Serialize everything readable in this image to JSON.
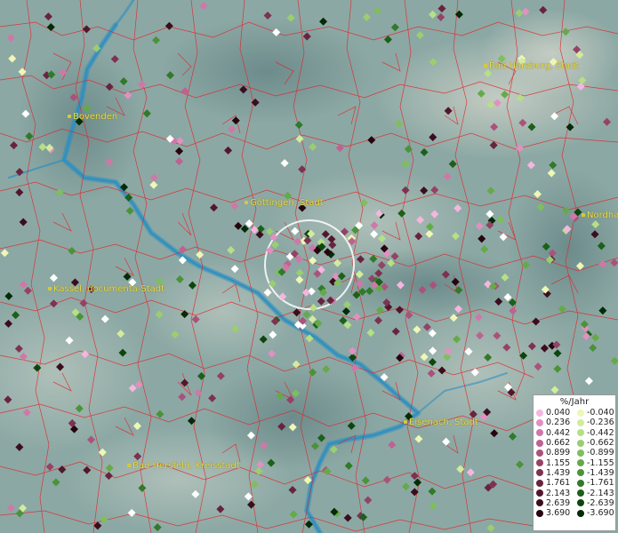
{
  "map": {
    "towns": [
      {
        "name": "Bad Harzburg, Stadt"
      },
      {
        "name": "Bovenden"
      },
      {
        "name": "Göttingen, Stadt"
      },
      {
        "name": "Nordhausen"
      },
      {
        "name": "Kassel, documenta-Stadt"
      },
      {
        "name": "Eisenach, Stadt"
      },
      {
        "name": "Bad Hersfeld, Kreisstadt"
      }
    ]
  },
  "legend": {
    "title": "%/Jahr",
    "positive": [
      {
        "label": "0.040",
        "color": "#f4b6df"
      },
      {
        "label": "0.236",
        "color": "#e190c2"
      },
      {
        "label": "0.442",
        "color": "#cf78a8"
      },
      {
        "label": "0.662",
        "color": "#bd6292"
      },
      {
        "label": "0.899",
        "color": "#a9527c"
      },
      {
        "label": "1.155",
        "color": "#944266"
      },
      {
        "label": "1.439",
        "color": "#7d3252"
      },
      {
        "label": "1.761",
        "color": "#68243f"
      },
      {
        "label": "2.143",
        "color": "#52172d"
      },
      {
        "label": "2.639",
        "color": "#3b0d1d"
      },
      {
        "label": "3.690",
        "color": "#26050f"
      }
    ],
    "negative": [
      {
        "label": "-0.040",
        "color": "#eef7b5"
      },
      {
        "label": "-0.236",
        "color": "#d2ec9c"
      },
      {
        "label": "-0.442",
        "color": "#b6df86"
      },
      {
        "label": "-0.662",
        "color": "#9ace70"
      },
      {
        "label": "-0.899",
        "color": "#7fbe5c"
      },
      {
        "label": "-1.155",
        "color": "#65aa49"
      },
      {
        "label": "-1.439",
        "color": "#4b9338"
      },
      {
        "label": "-1.761",
        "color": "#317a28"
      },
      {
        "label": "-2.143",
        "color": "#1c6019"
      },
      {
        "label": "-2.639",
        "color": "#0d460d"
      },
      {
        "label": "-3.690",
        "color": "#032b05"
      }
    ]
  }
}
